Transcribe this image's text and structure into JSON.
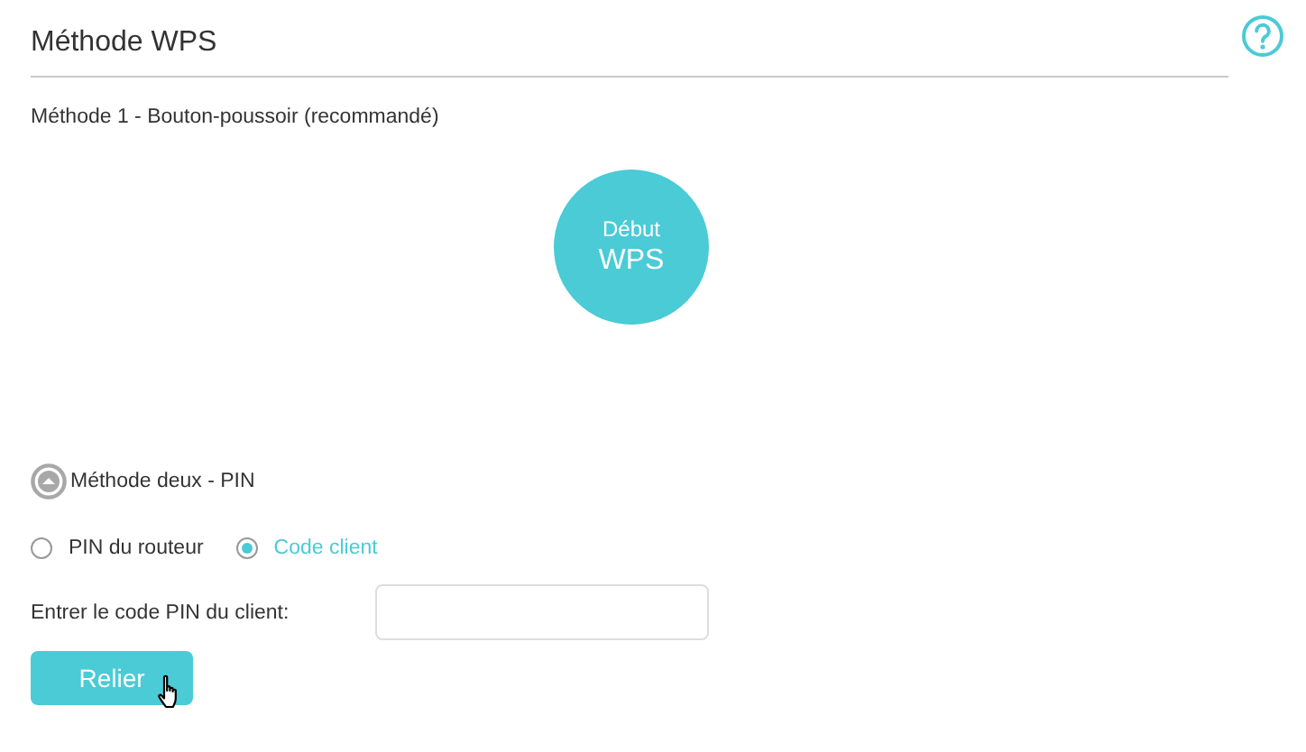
{
  "section": {
    "title": "Méthode WPS"
  },
  "method_one": {
    "title": "Méthode 1 - Bouton-poussoir (recommandé)",
    "button": {
      "line_1": "Début",
      "line_2": "WPS"
    }
  },
  "method_two": {
    "title": "Méthode deux - PIN",
    "expanded": true,
    "options": [
      {
        "label": "PIN du routeur",
        "selected": false
      },
      {
        "label": "Code client",
        "selected": true
      }
    ],
    "pin_field": {
      "label": "Entrer le code PIN du client:"
    },
    "button": "Relier"
  }
}
